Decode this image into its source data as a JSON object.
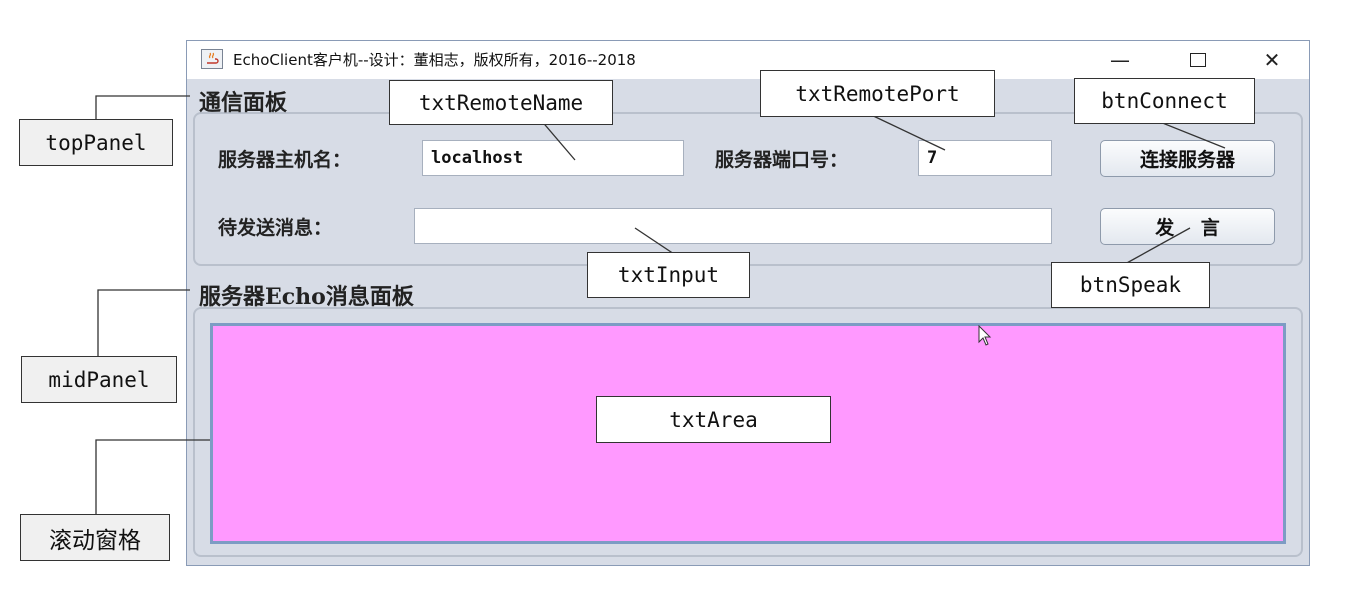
{
  "window": {
    "title": "EchoClient客户机--设计：董相志，版权所有，2016--2018",
    "controls": {
      "minimize": "—",
      "close": "✕"
    }
  },
  "top_panel": {
    "heading": "通信面板",
    "host_label": "服务器主机名：",
    "host_value": "localhost",
    "port_label": "服务器端口号：",
    "port_value": "7",
    "message_label": "待发送消息：",
    "message_value": "",
    "connect_button": "连接服务器",
    "speak_button": "发    言"
  },
  "mid_panel": {
    "heading": "服务器Echo消息面板",
    "text_area_value": "",
    "text_area_color": "#ff99ff"
  },
  "annotations": {
    "txtRemoteName": "txtRemoteName",
    "txtRemotePort": "txtRemotePort",
    "btnConnect": "btnConnect",
    "txtInput": "txtInput",
    "btnSpeak": "btnSpeak",
    "txtArea": "txtArea",
    "topPanel": "topPanel",
    "midPanel": "midPanel",
    "scrollPane": "滚动窗格"
  },
  "icons": {
    "app": "java-app-icon",
    "cursor": "mouse-pointer-icon"
  }
}
